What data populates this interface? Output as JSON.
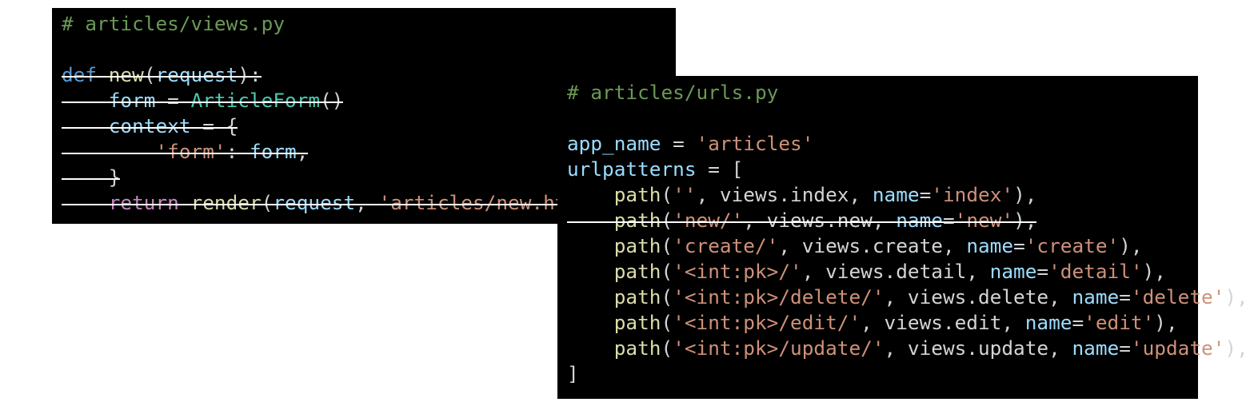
{
  "colors": {
    "background": "#000000",
    "comment": "#6a9955",
    "keyword": "#569cd6",
    "function": "#dcdcaa",
    "variable": "#9cdcfe",
    "class": "#4ec9b0",
    "string": "#ce9178",
    "control_keyword": "#c586c0",
    "text": "#d4d4d4",
    "strikethrough": "#ffffff"
  },
  "views_panel": {
    "lines": [
      {
        "struck": false,
        "tokens": [
          {
            "t": "# articles/views.py",
            "c": "comment"
          }
        ]
      },
      {
        "struck": false,
        "tokens": []
      },
      {
        "struck": true,
        "tokens": [
          {
            "t": "def",
            "c": "keyword"
          },
          {
            "t": " ",
            "c": "text"
          },
          {
            "t": "new",
            "c": "function"
          },
          {
            "t": "(",
            "c": "text"
          },
          {
            "t": "request",
            "c": "variable"
          },
          {
            "t": "):",
            "c": "text"
          }
        ]
      },
      {
        "struck": true,
        "tokens": [
          {
            "t": "    ",
            "c": "text"
          },
          {
            "t": "form",
            "c": "variable"
          },
          {
            "t": " = ",
            "c": "text"
          },
          {
            "t": "ArticleForm",
            "c": "class"
          },
          {
            "t": "()",
            "c": "text"
          }
        ]
      },
      {
        "struck": true,
        "tokens": [
          {
            "t": "    ",
            "c": "text"
          },
          {
            "t": "context",
            "c": "variable"
          },
          {
            "t": " = {",
            "c": "text"
          }
        ]
      },
      {
        "struck": true,
        "tokens": [
          {
            "t": "        ",
            "c": "text"
          },
          {
            "t": "'form'",
            "c": "string"
          },
          {
            "t": ": ",
            "c": "text"
          },
          {
            "t": "form",
            "c": "variable"
          },
          {
            "t": ",",
            "c": "text"
          }
        ]
      },
      {
        "struck": true,
        "tokens": [
          {
            "t": "    }",
            "c": "text"
          }
        ]
      },
      {
        "struck": true,
        "tokens": [
          {
            "t": "    ",
            "c": "text"
          },
          {
            "t": "return",
            "c": "control_keyword"
          },
          {
            "t": " ",
            "c": "text"
          },
          {
            "t": "render",
            "c": "function"
          },
          {
            "t": "(",
            "c": "text"
          },
          {
            "t": "request",
            "c": "variable"
          },
          {
            "t": ", ",
            "c": "text"
          },
          {
            "t": "'articles/new.html'",
            "c": "string"
          },
          {
            "t": ",",
            "c": "text"
          }
        ]
      }
    ]
  },
  "urls_panel": {
    "lines": [
      {
        "struck": false,
        "tokens": [
          {
            "t": "# articles/urls.py",
            "c": "comment"
          }
        ]
      },
      {
        "struck": false,
        "tokens": []
      },
      {
        "struck": false,
        "tokens": [
          {
            "t": "app_name",
            "c": "variable"
          },
          {
            "t": " = ",
            "c": "text"
          },
          {
            "t": "'articles'",
            "c": "string"
          }
        ]
      },
      {
        "struck": false,
        "tokens": [
          {
            "t": "urlpatterns",
            "c": "variable"
          },
          {
            "t": " = [",
            "c": "text"
          }
        ]
      },
      {
        "struck": false,
        "tokens": [
          {
            "t": "    ",
            "c": "text"
          },
          {
            "t": "path",
            "c": "function"
          },
          {
            "t": "(",
            "c": "text"
          },
          {
            "t": "''",
            "c": "string"
          },
          {
            "t": ", views.index, ",
            "c": "text"
          },
          {
            "t": "name",
            "c": "variable"
          },
          {
            "t": "=",
            "c": "text"
          },
          {
            "t": "'index'",
            "c": "string"
          },
          {
            "t": "),",
            "c": "text"
          }
        ]
      },
      {
        "struck": true,
        "tokens": [
          {
            "t": "    ",
            "c": "text"
          },
          {
            "t": "path",
            "c": "function"
          },
          {
            "t": "(",
            "c": "text"
          },
          {
            "t": "'new/'",
            "c": "string"
          },
          {
            "t": ", views.new, ",
            "c": "text"
          },
          {
            "t": "name",
            "c": "variable"
          },
          {
            "t": "=",
            "c": "text"
          },
          {
            "t": "'new'",
            "c": "string"
          },
          {
            "t": "),",
            "c": "text"
          }
        ]
      },
      {
        "struck": false,
        "tokens": [
          {
            "t": "    ",
            "c": "text"
          },
          {
            "t": "path",
            "c": "function"
          },
          {
            "t": "(",
            "c": "text"
          },
          {
            "t": "'create/'",
            "c": "string"
          },
          {
            "t": ", views.create, ",
            "c": "text"
          },
          {
            "t": "name",
            "c": "variable"
          },
          {
            "t": "=",
            "c": "text"
          },
          {
            "t": "'create'",
            "c": "string"
          },
          {
            "t": "),",
            "c": "text"
          }
        ]
      },
      {
        "struck": false,
        "tokens": [
          {
            "t": "    ",
            "c": "text"
          },
          {
            "t": "path",
            "c": "function"
          },
          {
            "t": "(",
            "c": "text"
          },
          {
            "t": "'<int:pk>/'",
            "c": "string"
          },
          {
            "t": ", views.detail, ",
            "c": "text"
          },
          {
            "t": "name",
            "c": "variable"
          },
          {
            "t": "=",
            "c": "text"
          },
          {
            "t": "'detail'",
            "c": "string"
          },
          {
            "t": "),",
            "c": "text"
          }
        ]
      },
      {
        "struck": false,
        "tokens": [
          {
            "t": "    ",
            "c": "text"
          },
          {
            "t": "path",
            "c": "function"
          },
          {
            "t": "(",
            "c": "text"
          },
          {
            "t": "'<int:pk>/delete/'",
            "c": "string"
          },
          {
            "t": ", views.delete, ",
            "c": "text"
          },
          {
            "t": "name",
            "c": "variable"
          },
          {
            "t": "=",
            "c": "text"
          },
          {
            "t": "'delete'",
            "c": "string"
          },
          {
            "t": "),",
            "c": "text"
          }
        ]
      },
      {
        "struck": false,
        "tokens": [
          {
            "t": "    ",
            "c": "text"
          },
          {
            "t": "path",
            "c": "function"
          },
          {
            "t": "(",
            "c": "text"
          },
          {
            "t": "'<int:pk>/edit/'",
            "c": "string"
          },
          {
            "t": ", views.edit, ",
            "c": "text"
          },
          {
            "t": "name",
            "c": "variable"
          },
          {
            "t": "=",
            "c": "text"
          },
          {
            "t": "'edit'",
            "c": "string"
          },
          {
            "t": "),",
            "c": "text"
          }
        ]
      },
      {
        "struck": false,
        "tokens": [
          {
            "t": "    ",
            "c": "text"
          },
          {
            "t": "path",
            "c": "function"
          },
          {
            "t": "(",
            "c": "text"
          },
          {
            "t": "'<int:pk>/update/'",
            "c": "string"
          },
          {
            "t": ", views.update, ",
            "c": "text"
          },
          {
            "t": "name",
            "c": "variable"
          },
          {
            "t": "=",
            "c": "text"
          },
          {
            "t": "'update'",
            "c": "string"
          },
          {
            "t": "),",
            "c": "text"
          }
        ]
      },
      {
        "struck": false,
        "tokens": [
          {
            "t": "]",
            "c": "text"
          }
        ]
      }
    ]
  }
}
